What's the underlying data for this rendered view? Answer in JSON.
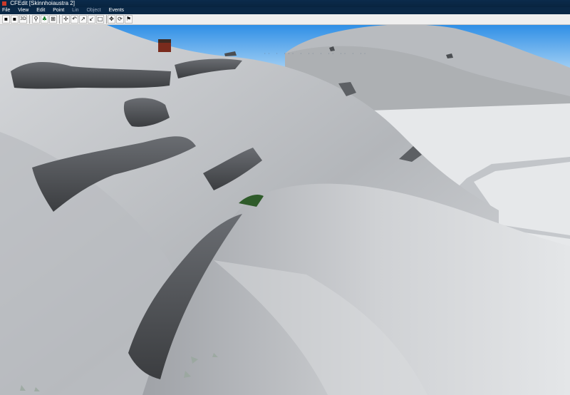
{
  "window": {
    "title": "CFEdit [Skinnhoiaustra 2]"
  },
  "menu": {
    "items": [
      "File",
      "View",
      "Edit",
      "Point",
      "Lin",
      "Object",
      "Events"
    ],
    "disabled": [
      "Lin",
      "Object"
    ]
  },
  "toolbar": {
    "buttons": [
      {
        "name": "save-icon",
        "glyph": "▪"
      },
      {
        "name": "open-icon",
        "glyph": "▪"
      },
      {
        "name": "3d-view-icon",
        "glyph": "3D"
      },
      {
        "name": "person-icon",
        "glyph": "⚲"
      },
      {
        "name": "tree-icon",
        "glyph": "♣"
      },
      {
        "name": "grid-icon",
        "glyph": "⊞"
      },
      {
        "name": "point-add-icon",
        "glyph": "✢"
      },
      {
        "name": "point-remove-icon",
        "glyph": "↶"
      },
      {
        "name": "point-move-icon",
        "glyph": "↗"
      },
      {
        "name": "line-icon",
        "glyph": "↙"
      },
      {
        "name": "box-icon",
        "glyph": "□"
      },
      {
        "name": "move-tool-icon",
        "glyph": "✥"
      },
      {
        "name": "rotate-tool-icon",
        "glyph": "⟳"
      },
      {
        "name": "flag-icon",
        "glyph": "⚑"
      }
    ]
  },
  "scene": {
    "colors": {
      "sky_top": "#2f8fe6",
      "sky_bottom": "#b9dcf7",
      "snow_light": "#e6e8ea",
      "snow_mid": "#c9cbcf",
      "snow_dark": "#8b8e93",
      "rock": "#5a5d62",
      "rock_dark": "#3b3d40",
      "building_red": "#7a2b1d"
    }
  }
}
